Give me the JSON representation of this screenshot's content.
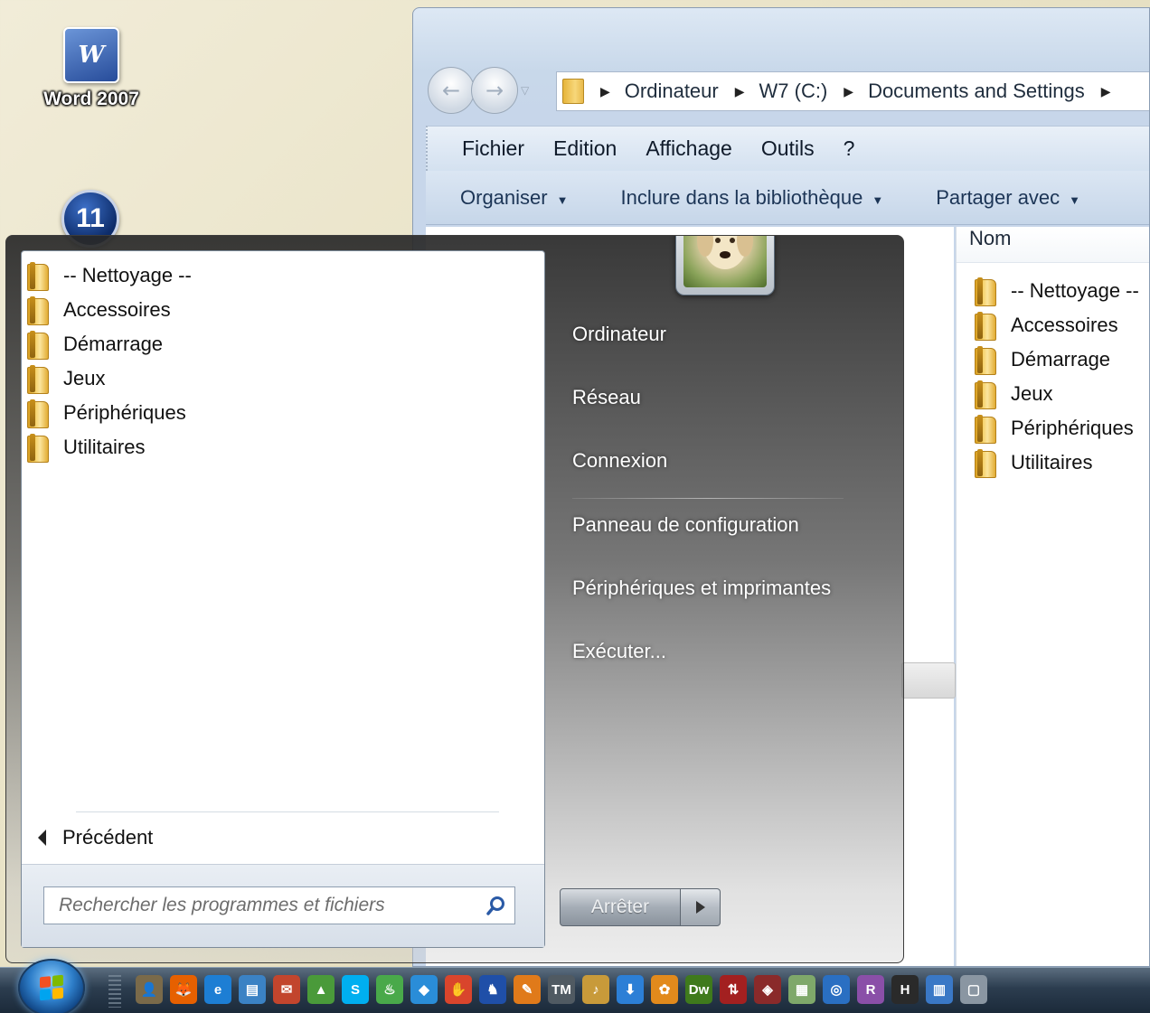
{
  "desktop": {
    "icon_label": "Word 2007",
    "icon_glyph": "W",
    "step_badge": "11"
  },
  "explorer": {
    "breadcrumb": [
      "Ordinateur",
      "W7 (C:)",
      "Documents and Settings"
    ],
    "menu": [
      "Fichier",
      "Edition",
      "Affichage",
      "Outils",
      "?"
    ],
    "toolbar": [
      "Organiser",
      "Inclure dans la bibliothèque",
      "Partager avec"
    ],
    "column_header": "Nom",
    "files": [
      "-- Nettoyage --",
      "Accessoires",
      "Démarrage",
      "Jeux",
      "Périphériques",
      "Utilitaires"
    ]
  },
  "start_menu": {
    "programs": [
      "-- Nettoyage --",
      "Accessoires",
      "Démarrage",
      "Jeux",
      "Périphériques",
      "Utilitaires"
    ],
    "back_label": "Précédent",
    "search_placeholder": "Rechercher les programmes et fichiers",
    "right_items": [
      "Ordinateur",
      "Réseau",
      "Connexion",
      "Panneau de configuration",
      "Périphériques et imprimantes",
      "Exécuter..."
    ],
    "shutdown_label": "Arrêter"
  },
  "taskbar": {
    "icons": [
      {
        "name": "user-profile-icon",
        "glyph": "👤",
        "color": "#7a6a4a"
      },
      {
        "name": "firefox-icon",
        "glyph": "🦊",
        "color": "#e66000"
      },
      {
        "name": "internet-explorer-icon",
        "glyph": "e",
        "color": "#1d7ed4"
      },
      {
        "name": "printer-icon",
        "glyph": "▤",
        "color": "#3b82c4"
      },
      {
        "name": "mail-icon",
        "glyph": "✉",
        "color": "#c2452d"
      },
      {
        "name": "photo-gallery-icon",
        "glyph": "▲",
        "color": "#4a9a3a"
      },
      {
        "name": "skype-icon",
        "glyph": "S",
        "color": "#00aff0"
      },
      {
        "name": "flame-icon",
        "glyph": "♨",
        "color": "#49a94a"
      },
      {
        "name": "cube-icon",
        "glyph": "◆",
        "color": "#2a8dd8"
      },
      {
        "name": "hand-icon",
        "glyph": "✋",
        "color": "#d9452c"
      },
      {
        "name": "chess-icon",
        "glyph": "♞",
        "color": "#1f4fa8"
      },
      {
        "name": "brush-icon",
        "glyph": "✎",
        "color": "#e07a1a"
      },
      {
        "name": "tm-icon",
        "glyph": "TM",
        "color": "#505a62"
      },
      {
        "name": "music-icon",
        "glyph": "♪",
        "color": "#c89a3a"
      },
      {
        "name": "download-icon",
        "glyph": "⬇",
        "color": "#2c7fd6"
      },
      {
        "name": "palette-icon",
        "glyph": "✿",
        "color": "#e28a1c"
      },
      {
        "name": "dreamweaver-icon",
        "glyph": "Dw",
        "color": "#3f7a1c"
      },
      {
        "name": "ftp-icon",
        "glyph": "⇅",
        "color": "#a32020"
      },
      {
        "name": "network-icon",
        "glyph": "◈",
        "color": "#8a2a2a"
      },
      {
        "name": "notepad-icon",
        "glyph": "▦",
        "color": "#7fa86a"
      },
      {
        "name": "outlook-icon",
        "glyph": "◎",
        "color": "#2a6fc2"
      },
      {
        "name": "r-icon",
        "glyph": "R",
        "color": "#8a4fa8"
      },
      {
        "name": "h-icon",
        "glyph": "H",
        "color": "#2a2a2a"
      },
      {
        "name": "window-icon",
        "glyph": "▥",
        "color": "#3a78c6"
      },
      {
        "name": "extra-icon",
        "glyph": "▢",
        "color": "#8a96a2"
      }
    ]
  }
}
